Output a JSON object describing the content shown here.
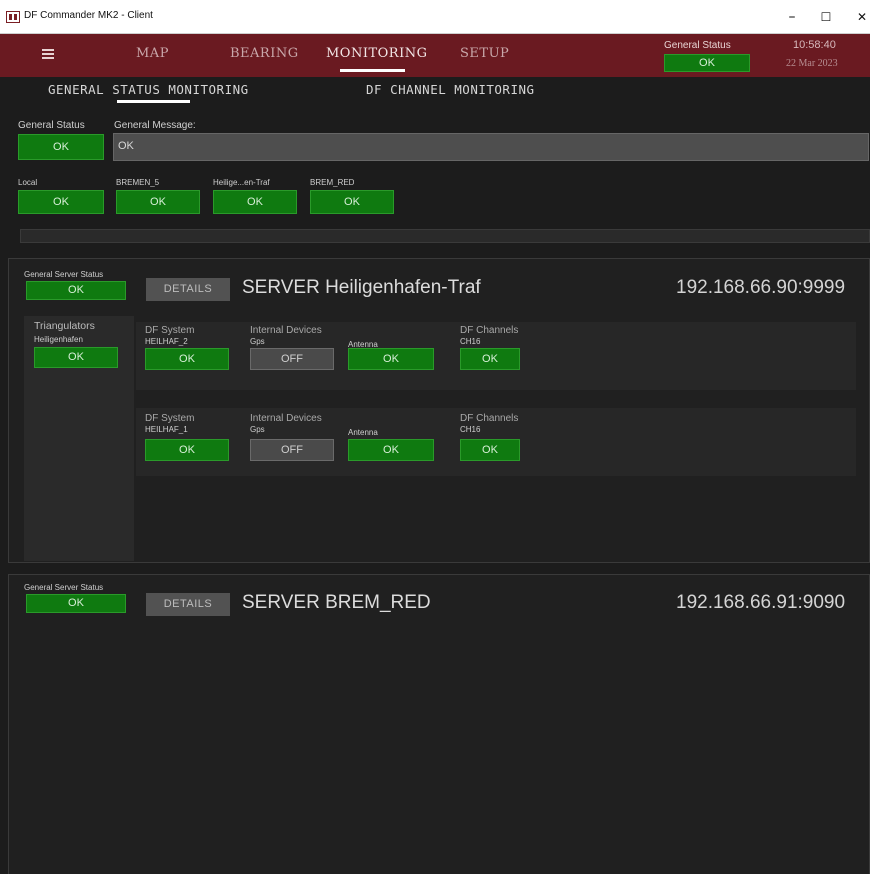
{
  "window": {
    "title": "DF Commander MK2 - Client",
    "minimize": "–",
    "maximize": "☐",
    "close": "✕"
  },
  "nav": {
    "items": [
      "MAP",
      "BEARING",
      "MONITORING",
      "SETUP"
    ],
    "active": "MONITORING",
    "general_status_label": "General Status",
    "general_status_value": "OK",
    "time": "10:58:40",
    "date": "22 Mar 2023"
  },
  "subtabs": [
    "GENERAL STATUS MONITORING",
    "DF CHANNEL MONITORING"
  ],
  "general": {
    "status_label": "General Status",
    "status_value": "OK",
    "message_label": "General Message:",
    "message_value": "OK"
  },
  "stations": [
    {
      "name": "Local",
      "status": "OK"
    },
    {
      "name": "BREMEN_5",
      "status": "OK"
    },
    {
      "name": "Heilige...en-Traf",
      "status": "OK"
    },
    {
      "name": "BREM_RED",
      "status": "OK"
    }
  ],
  "servers": [
    {
      "status_label": "General Server Status",
      "status": "OK",
      "details_label": "DETAILS",
      "name": "SERVER Heiligenhafen-Traf",
      "address": "192.168.66.90:9999",
      "triangulators_label": "Triangulators",
      "triangulator_name": "Heiligenhafen",
      "triangulator_status": "OK",
      "systems": [
        {
          "system_label": "DF System",
          "system_name": "HEILHAF_2",
          "system_status": "OK",
          "devices_label": "Internal Devices",
          "gps_label": "Gps",
          "gps_status": "OFF",
          "antenna_label": "Antenna",
          "antenna_status": "OK",
          "channels_label": "DF Channels",
          "channel_name": "CH16",
          "channel_status": "OK"
        },
        {
          "system_label": "DF System",
          "system_name": "HEILHAF_1",
          "system_status": "OK",
          "devices_label": "Internal Devices",
          "gps_label": "Gps",
          "gps_status": "OFF",
          "antenna_label": "Antenna",
          "antenna_status": "OK",
          "channels_label": "DF Channels",
          "channel_name": "CH16",
          "channel_status": "OK"
        }
      ]
    },
    {
      "status_label": "General Server Status",
      "status": "OK",
      "details_label": "DETAILS",
      "name": "SERVER BREM_RED",
      "address": "192.168.66.91:9090"
    }
  ],
  "colors": {
    "titlebar": "#6a1a21",
    "ok": "#0f7a10",
    "off": "#4a4a4a",
    "background": "#1c1c1c"
  }
}
